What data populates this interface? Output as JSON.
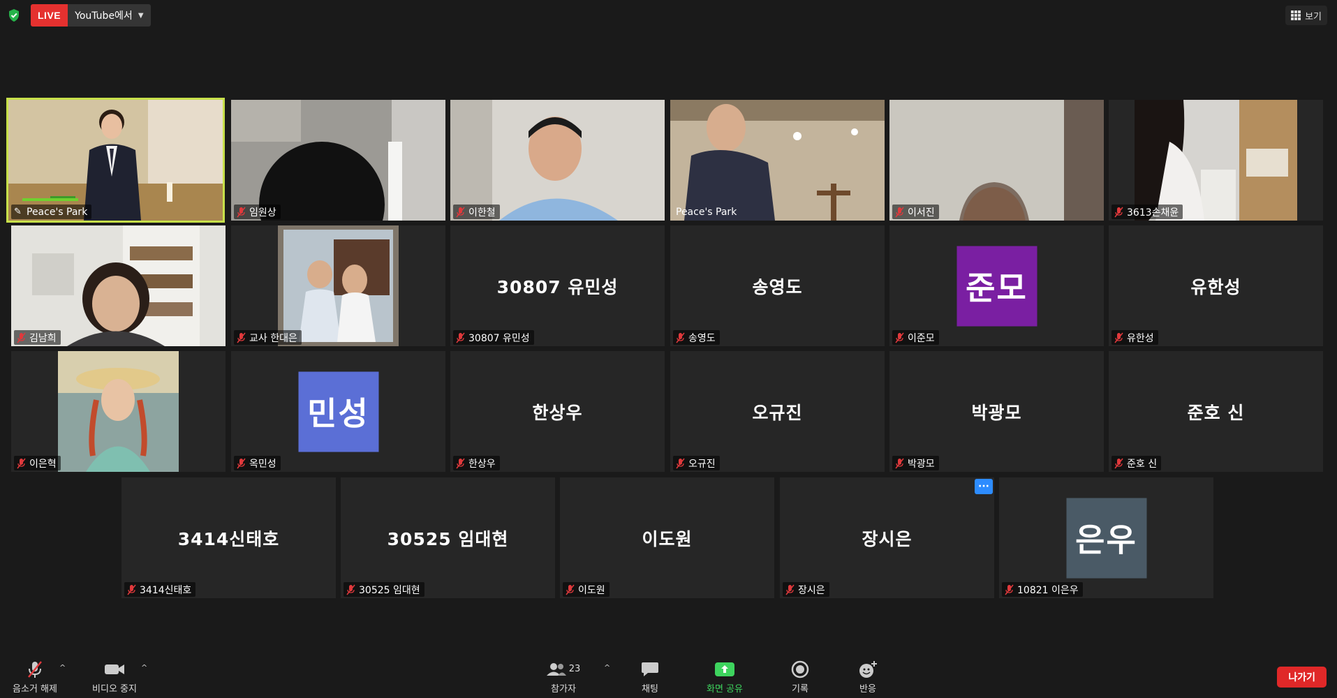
{
  "topbar": {
    "live_label": "LIVE",
    "stream_target": "YouTube에서",
    "view_label": "보기"
  },
  "tiles": [
    {
      "name": "Peace's Park",
      "display": "",
      "status": "speaking-pinned"
    },
    {
      "name": "임원상",
      "display": ""
    },
    {
      "name": "이한철",
      "display": ""
    },
    {
      "name": "Peace's Park",
      "display": ""
    },
    {
      "name": "이서진",
      "display": ""
    },
    {
      "name": "3613손채윤",
      "display": ""
    },
    {
      "name": "김남희",
      "display": ""
    },
    {
      "name": "교사 한대은",
      "display": ""
    },
    {
      "name": "30807 유민성",
      "display": "30807 유민성"
    },
    {
      "name": "송영도",
      "display": "송영도"
    },
    {
      "name": "이준모",
      "display": "준모",
      "avatar_color": "#7a1fa2"
    },
    {
      "name": "유한성",
      "display": "유한성"
    },
    {
      "name": "이은혁",
      "display": ""
    },
    {
      "name": "옥민성",
      "display": "민성",
      "avatar_color": "#5b6fd6"
    },
    {
      "name": "한상우",
      "display": "한상우"
    },
    {
      "name": "오규진",
      "display": "오규진"
    },
    {
      "name": "박광모",
      "display": "박광모"
    },
    {
      "name": "준호 신",
      "display": "준호 신"
    },
    {
      "name": "3414신태호",
      "display": "3414신태호"
    },
    {
      "name": "30525 임대현",
      "display": "30525 임대현"
    },
    {
      "name": "이도원",
      "display": "이도원"
    },
    {
      "name": "장시은",
      "display": "장시은",
      "more_menu": "···"
    },
    {
      "name": "10821 이은우",
      "display": "은우",
      "avatar_color": "#4a5a66"
    }
  ],
  "toolbar": {
    "unmute_label": "음소거 해제",
    "stop_video_label": "비디오 중지",
    "participants_label": "참가자",
    "participants_count": "23",
    "chat_label": "채팅",
    "share_label": "화면 공유",
    "record_label": "기록",
    "reactions_label": "반응",
    "leave_label": "나가기"
  },
  "colors": {
    "background": "#1a1a1a",
    "tile": "#262626",
    "live_red": "#e5312f",
    "speaker_outline": "#c7e04a",
    "share_green": "#3ed45e",
    "leave_red": "#e02828",
    "mute_red": "#e0393c"
  }
}
